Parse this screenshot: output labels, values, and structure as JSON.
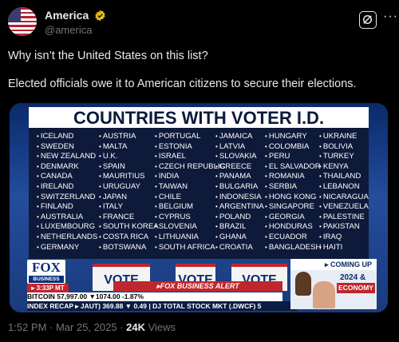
{
  "account": {
    "name": "America",
    "handle": "@america"
  },
  "post": {
    "line1": "Why isn’t the United States on this list?",
    "line2": "Elected officials owe it to American citizens to secure their elections."
  },
  "media": {
    "board_title": "COUNTRIES WITH VOTER I.D.",
    "columns": [
      [
        "ICELAND",
        "SWEDEN",
        "NEW ZEALAND",
        "DENMARK",
        "CANADA",
        "IRELAND",
        "SWITZERLAND",
        "FINLAND",
        "AUSTRALIA",
        "LUXEMBOURG",
        "NETHERLANDS",
        "GERMANY"
      ],
      [
        "AUSTRIA",
        "MALTA",
        "U.K.",
        "SPAIN",
        "MAURITIUS",
        "URUGUAY",
        "JAPAN",
        "ITALY",
        "FRANCE",
        "SOUTH KOREA",
        "COSTA RICA",
        "BOTSWANA"
      ],
      [
        "PORTUGAL",
        "ESTONIA",
        "ISRAEL",
        "CZECH REPUBLIC",
        "INDIA",
        "TAIWAN",
        "CHILE",
        "BELGIUM",
        "CYPRUS",
        "SLOVENIA",
        "LITHUANIA",
        "SOUTH AFRICA"
      ],
      [
        "JAMAICA",
        "LATVIA",
        "SLOVAKIA",
        "GREECE",
        "PANAMA",
        "BULGARIA",
        "INDONESIA",
        "ARGENTINA",
        "POLAND",
        "BRAZIL",
        "GHANA",
        "CROATIA"
      ],
      [
        "HUNGARY",
        "COLOMBIA",
        "PERU",
        "EL SALVADOR",
        "ROMANIA",
        "SERBIA",
        "HONG KONG",
        "SINGAPORE",
        "GEORGIA",
        "HONDURAS",
        "ECUADOR",
        "BANGLADESH"
      ],
      [
        "UKRAINE",
        "BOLIVIA",
        "TURKEY",
        "KENYA",
        "THAILAND",
        "LEBANON",
        "NICARAGUA",
        "VENEZUELA",
        "PALESTINE",
        "PAKISTAN",
        "IRAQ",
        "HAITI"
      ]
    ],
    "vote_signs": [
      "VOTE",
      "VOTE",
      "VOTE",
      "VO"
    ],
    "logo_top": "FOX",
    "logo_bottom": "BUSINESS",
    "time": "▸ 3:33P MT",
    "alert": "▸FOX BUSINESS ALERT",
    "ticker1": "BITCOIN  57,997.00 ▼1074.00  -1.87%",
    "ticker2": "INDEX RECAP  ▸ JAUT)  369.88  ▼ 0.49  |  DJ TOTAL STOCK MKT (.DWCF)  5",
    "coming_up": "▸ COMING UP",
    "promo_year": "2024 &",
    "promo_label": "ECONOMY"
  },
  "footer": {
    "time": "1:52 PM · Mar 25, 2025 · ",
    "views": "24K",
    "views_label": " Views"
  },
  "colors": {
    "background": "#000000",
    "text": "#e7e9ea",
    "muted": "#71767b",
    "fox_red": "#c0262d"
  }
}
